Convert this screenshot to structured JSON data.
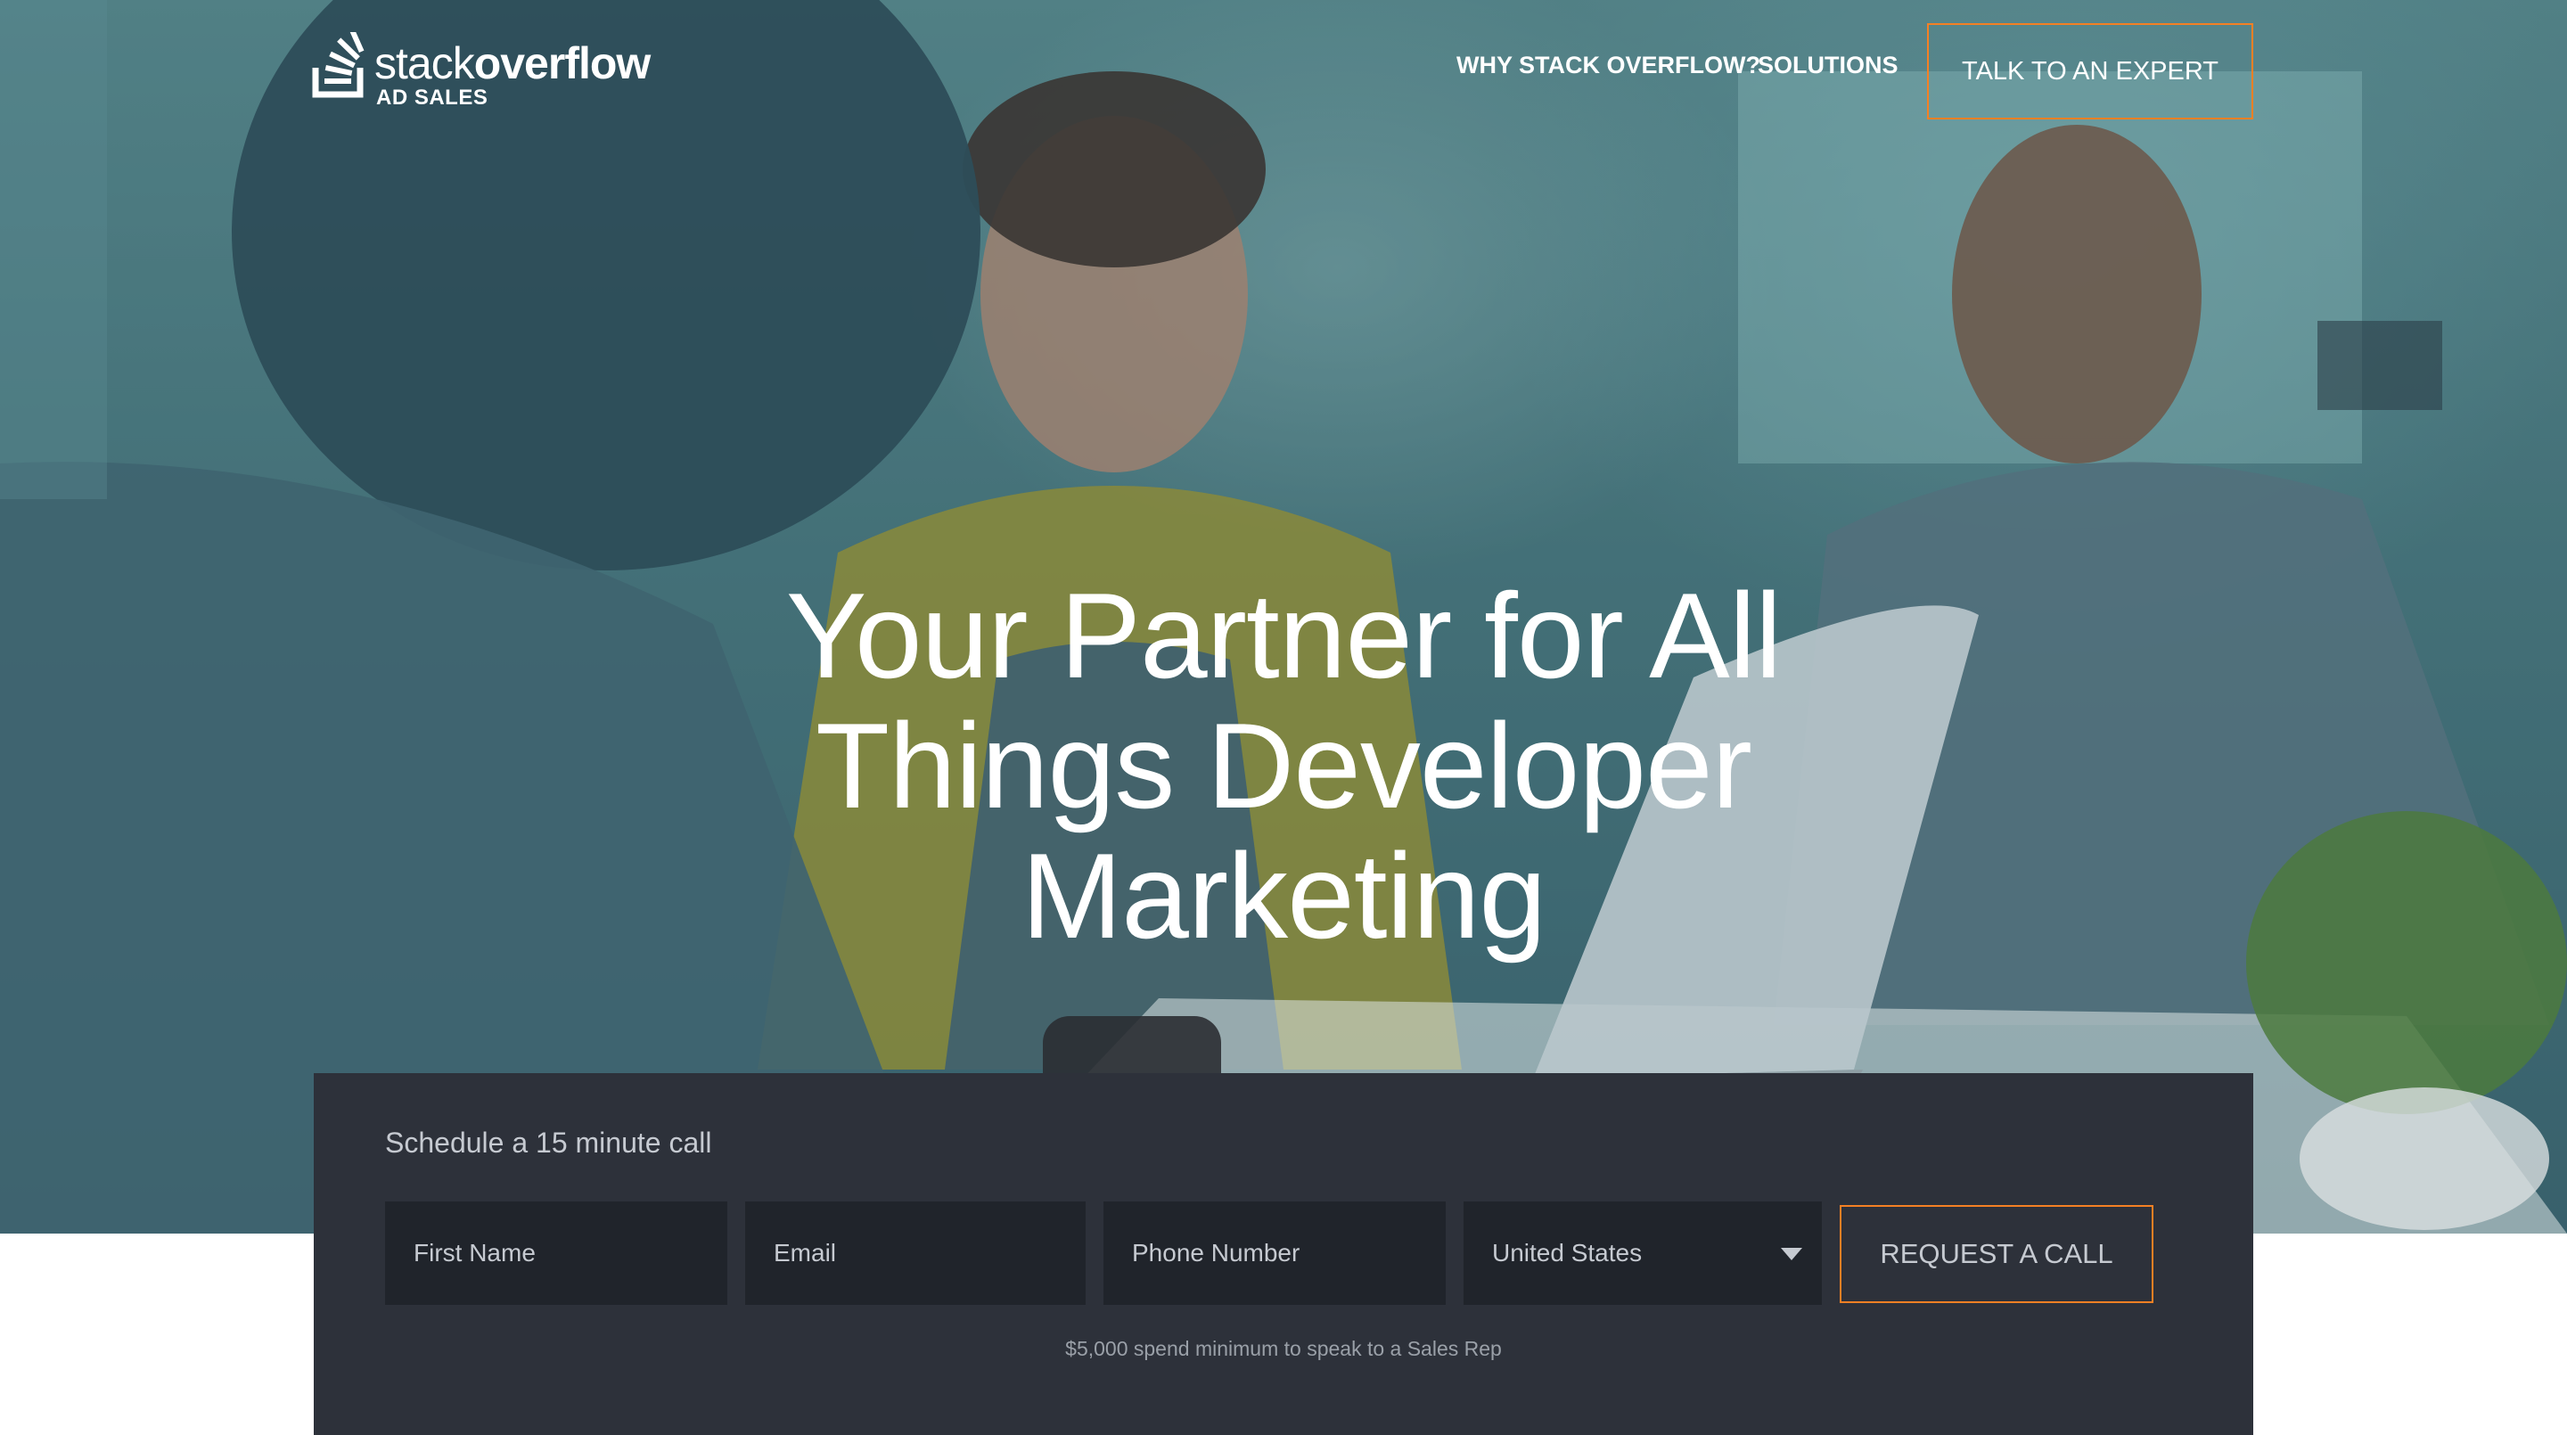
{
  "nav": {
    "logo": {
      "brand_light": "stack",
      "brand_bold": "overflow",
      "subtitle": "AD SALES"
    },
    "links": [
      "WHY STACK OVERFLOW?",
      "SOLUTIONS"
    ],
    "cta_label": "TALK TO AN EXPERT"
  },
  "hero": {
    "headline_lines": [
      "Your Partner for All",
      "Things Developer",
      "Marketing"
    ]
  },
  "form": {
    "title": "Schedule a 15 minute call",
    "first_name_placeholder": "First Name",
    "email_placeholder": "Email",
    "phone_placeholder": "Phone Number",
    "country_selected": "United States",
    "submit_label": "REQUEST A CALL",
    "note": "$5,000 spend minimum to speak to a Sales Rep"
  },
  "colors": {
    "accent": "#f48024",
    "hero_overlay": "#3e6570",
    "form_panel": "#2d313a",
    "input_bg": "#20242b"
  }
}
